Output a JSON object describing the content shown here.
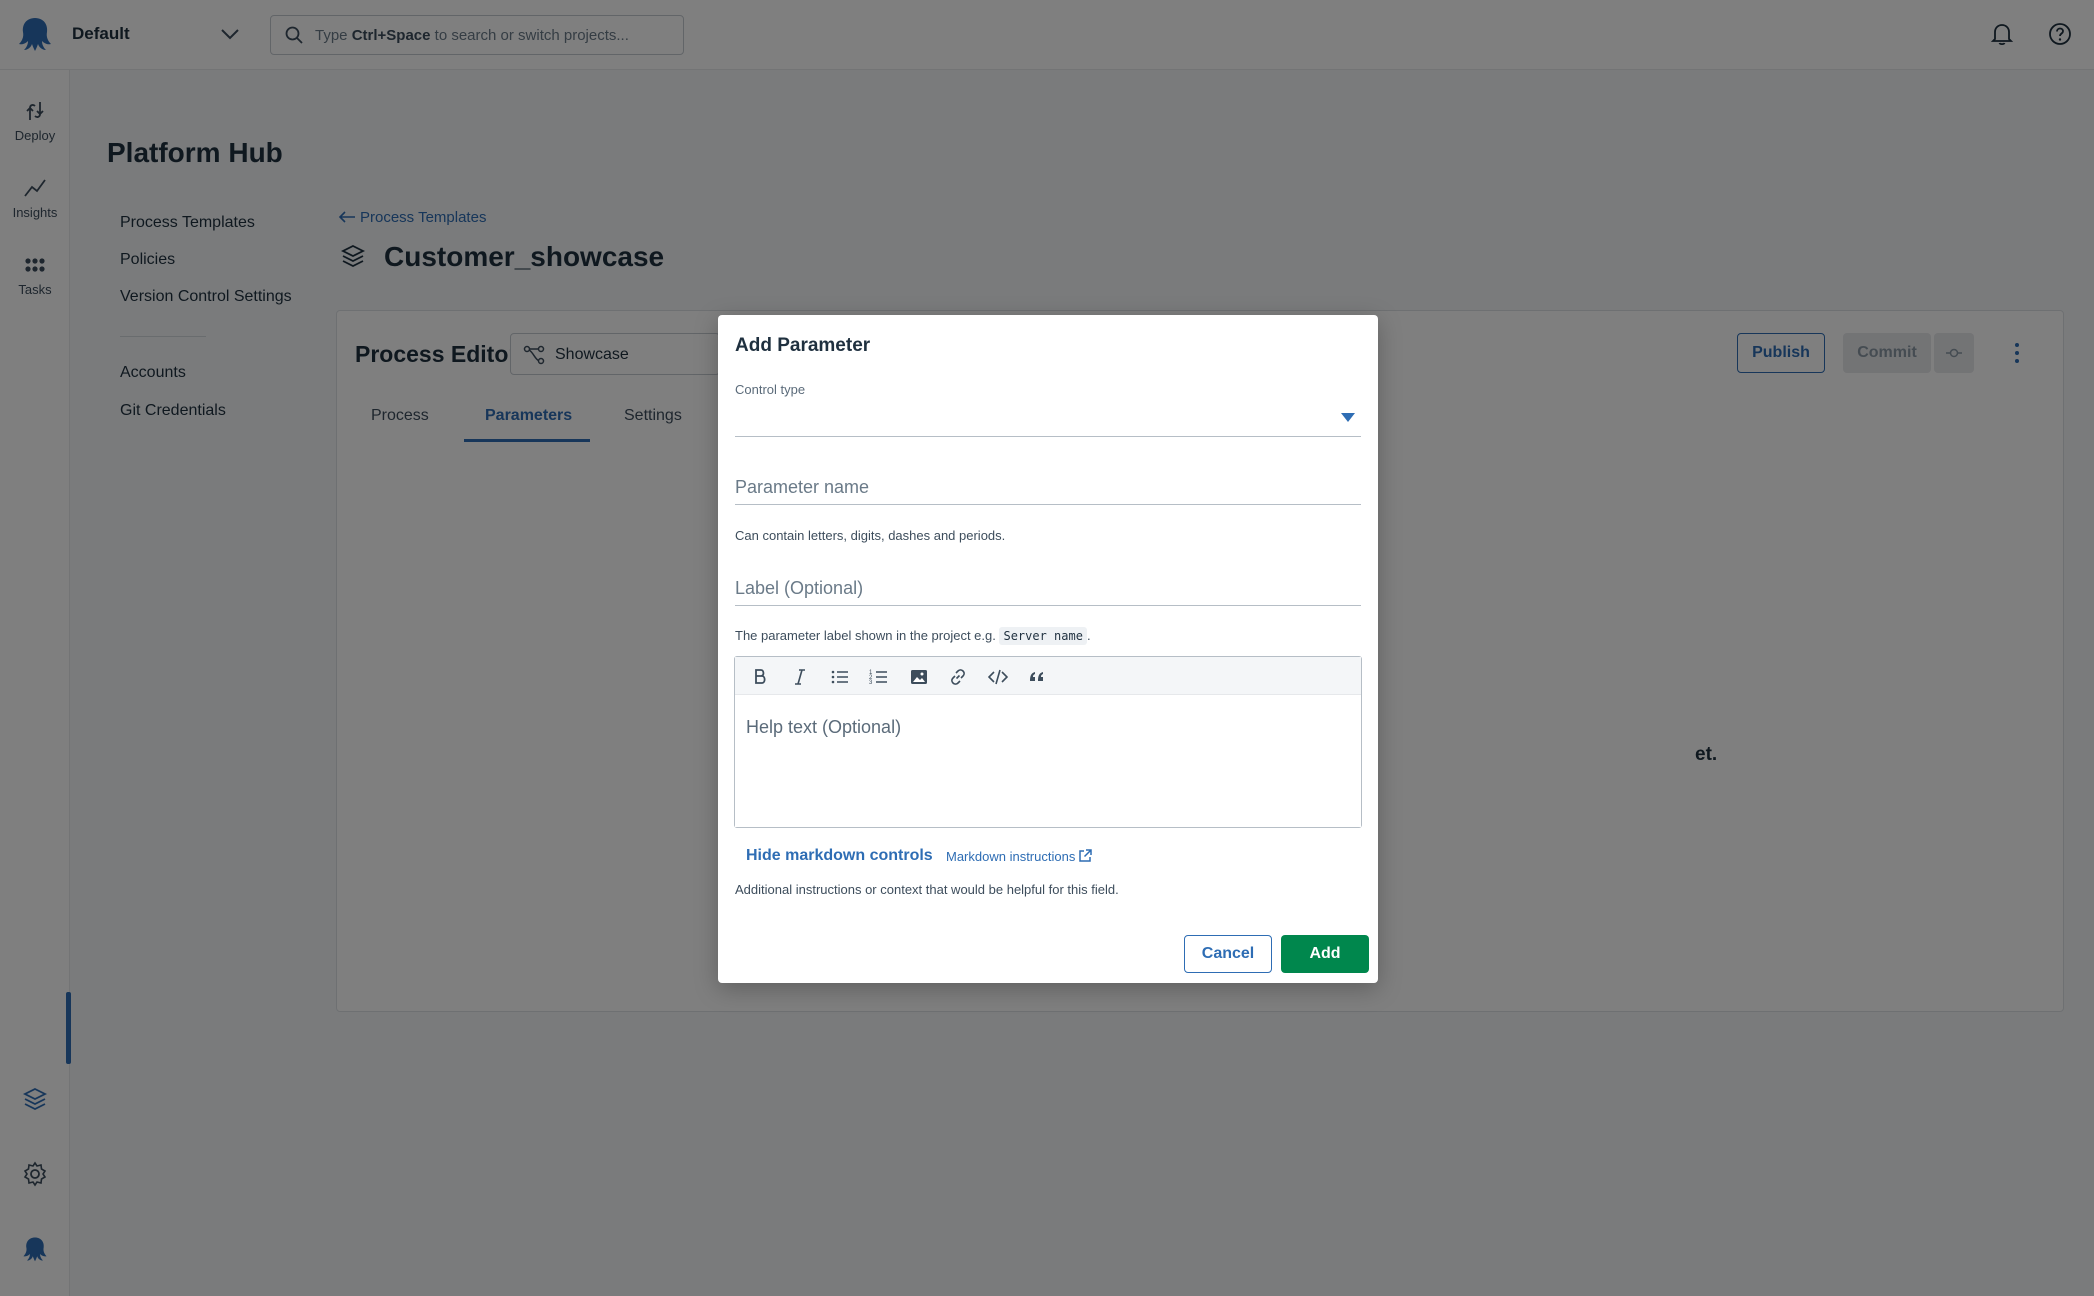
{
  "topbar": {
    "space_name": "Default",
    "search_prefix": "Type ",
    "search_shortcut": "Ctrl+Space",
    "search_suffix": " to search or switch projects..."
  },
  "rail": {
    "items": [
      {
        "label": "Deploy",
        "icon": "deploy-icon"
      },
      {
        "label": "Insights",
        "icon": "insights-icon"
      },
      {
        "label": "Tasks",
        "icon": "tasks-icon"
      }
    ],
    "bottom_icons": [
      "platform-hub-icon",
      "gear-icon",
      "octopus-icon"
    ]
  },
  "hub": {
    "title": "Platform Hub",
    "nav": [
      "Process Templates",
      "Policies",
      "Version Control Settings",
      "Accounts",
      "Git Credentials"
    ]
  },
  "page": {
    "breadcrumb": "Process Templates",
    "title": "Customer_showcase"
  },
  "editor": {
    "title": "Process Editor",
    "branch": "Showcase",
    "tabs": [
      "Process",
      "Parameters",
      "Settings"
    ],
    "active_tab": "Parameters",
    "publish_label": "Publish",
    "commit_label": "Commit",
    "empty_fragment": "et."
  },
  "dialog": {
    "title": "Add Parameter",
    "control_type_label": "Control type",
    "parameter_name_placeholder": "Parameter name",
    "parameter_name_hint": "Can contain letters, digits, dashes and periods.",
    "label_placeholder": "Label (Optional)",
    "label_hint_prefix": "The parameter label shown in the project e.g. ",
    "label_hint_example": "Server name",
    "label_hint_suffix": ".",
    "help_placeholder": "Help text (Optional)",
    "hide_markdown": "Hide markdown controls",
    "markdown_instructions": "Markdown instructions",
    "help_hint": "Additional instructions or context that would be helpful for this field.",
    "cancel_label": "Cancel",
    "add_label": "Add"
  },
  "colors": {
    "accent": "#2e6db4",
    "add_button": "#00874d",
    "text": "#1f303f"
  }
}
